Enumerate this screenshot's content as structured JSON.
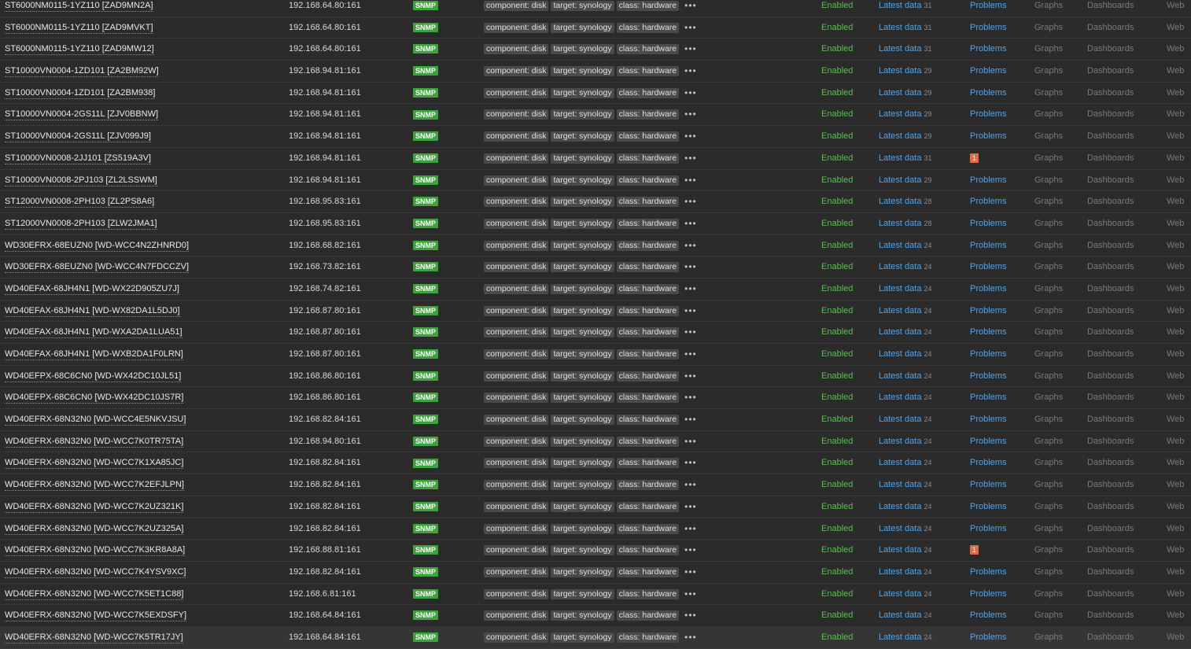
{
  "interface_label": "SNMP",
  "tags": [
    "component: disk",
    "target: synology",
    "class: hardware"
  ],
  "more_label": "•••",
  "status_label": "Enabled",
  "latest_label": "Latest data",
  "problems_label": "Problems",
  "graphs_label": "Graphs",
  "dashboards_label": "Dashboards",
  "web_label": "Web",
  "colors": {
    "background": "#2b2b2b",
    "snmp_badge": "#3ca43b",
    "enabled": "#58c04f",
    "link": "#4ea4f0",
    "problem_badge": "#e56a43"
  },
  "hosts": [
    {
      "name": "ST6000NM0115-1YZ110 [ZAD9MN2A]",
      "ip": "192.168.64.80:161",
      "latest_count": "31",
      "problems": null
    },
    {
      "name": "ST6000NM0115-1YZ110 [ZAD9MVKT]",
      "ip": "192.168.64.80:161",
      "latest_count": "31",
      "problems": null
    },
    {
      "name": "ST6000NM0115-1YZ110 [ZAD9MW12]",
      "ip": "192.168.64.80:161",
      "latest_count": "31",
      "problems": null
    },
    {
      "name": "ST10000VN0004-1ZD101 [ZA2BM92W]",
      "ip": "192.168.94.81:161",
      "latest_count": "29",
      "problems": null
    },
    {
      "name": "ST10000VN0004-1ZD101 [ZA2BM938]",
      "ip": "192.168.94.81:161",
      "latest_count": "29",
      "problems": null
    },
    {
      "name": "ST10000VN0004-2GS11L [ZJV0BBNW]",
      "ip": "192.168.94.81:161",
      "latest_count": "29",
      "problems": null
    },
    {
      "name": "ST10000VN0004-2GS11L [ZJV099J9]",
      "ip": "192.168.94.81:161",
      "latest_count": "29",
      "problems": null
    },
    {
      "name": "ST10000VN0008-2JJ101 [ZS519A3V]",
      "ip": "192.168.94.81:161",
      "latest_count": "31",
      "problems": "1"
    },
    {
      "name": "ST10000VN0008-2PJ103 [ZL2LSSWM]",
      "ip": "192.168.94.81:161",
      "latest_count": "29",
      "problems": null
    },
    {
      "name": "ST12000VN0008-2PH103 [ZL2PS8A6]",
      "ip": "192.168.95.83:161",
      "latest_count": "28",
      "problems": null
    },
    {
      "name": "ST12000VN0008-2PH103 [ZLW2JMA1]",
      "ip": "192.168.95.83:161",
      "latest_count": "28",
      "problems": null
    },
    {
      "name": "WD30EFRX-68EUZN0 [WD-WCC4N2ZHNRD0]",
      "ip": "192.168.68.82:161",
      "latest_count": "24",
      "problems": null
    },
    {
      "name": "WD30EFRX-68EUZN0 [WD-WCC4N7FDCCZV]",
      "ip": "192.168.73.82:161",
      "latest_count": "24",
      "problems": null
    },
    {
      "name": "WD40EFAX-68JH4N1 [WD-WX22D905ZU7J]",
      "ip": "192.168.74.82:161",
      "latest_count": "24",
      "problems": null
    },
    {
      "name": "WD40EFAX-68JH4N1 [WD-WX82DA1L5DJ0]",
      "ip": "192.168.87.80:161",
      "latest_count": "24",
      "problems": null
    },
    {
      "name": "WD40EFAX-68JH4N1 [WD-WXA2DA1LUA51]",
      "ip": "192.168.87.80:161",
      "latest_count": "24",
      "problems": null
    },
    {
      "name": "WD40EFAX-68JH4N1 [WD-WXB2DA1F0LRN]",
      "ip": "192.168.87.80:161",
      "latest_count": "24",
      "problems": null
    },
    {
      "name": "WD40EFPX-68C6CN0 [WD-WX42DC10JL51]",
      "ip": "192.168.86.80:161",
      "latest_count": "24",
      "problems": null
    },
    {
      "name": "WD40EFPX-68C6CN0 [WD-WX42DC10JS7R]",
      "ip": "192.168.86.80:161",
      "latest_count": "24",
      "problems": null
    },
    {
      "name": "WD40EFRX-68N32N0 [WD-WCC4E5NKVJSU]",
      "ip": "192.168.82.84:161",
      "latest_count": "24",
      "problems": null
    },
    {
      "name": "WD40EFRX-68N32N0 [WD-WCC7K0TR75TA]",
      "ip": "192.168.94.80:161",
      "latest_count": "24",
      "problems": null
    },
    {
      "name": "WD40EFRX-68N32N0 [WD-WCC7K1XA85JC]",
      "ip": "192.168.82.84:161",
      "latest_count": "24",
      "problems": null
    },
    {
      "name": "WD40EFRX-68N32N0 [WD-WCC7K2EFJLPN]",
      "ip": "192.168.82.84:161",
      "latest_count": "24",
      "problems": null
    },
    {
      "name": "WD40EFRX-68N32N0 [WD-WCC7K2UZ321K]",
      "ip": "192.168.82.84:161",
      "latest_count": "24",
      "problems": null
    },
    {
      "name": "WD40EFRX-68N32N0 [WD-WCC7K2UZ325A]",
      "ip": "192.168.82.84:161",
      "latest_count": "24",
      "problems": null
    },
    {
      "name": "WD40EFRX-68N32N0 [WD-WCC7K3KR8A8A]",
      "ip": "192.168.88.81:161",
      "latest_count": "24",
      "problems": "1"
    },
    {
      "name": "WD40EFRX-68N32N0 [WD-WCC7K4YSV9XC]",
      "ip": "192.168.82.84:161",
      "latest_count": "24",
      "problems": null
    },
    {
      "name": "WD40EFRX-68N32N0 [WD-WCC7K5ET1C88]",
      "ip": "192.168.6.81:161",
      "latest_count": "24",
      "problems": null
    },
    {
      "name": "WD40EFRX-68N32N0 [WD-WCC7K5EXDSFY]",
      "ip": "192.168.64.84:161",
      "latest_count": "24",
      "problems": null
    },
    {
      "name": "WD40EFRX-68N32N0 [WD-WCC7K5TR17JY]",
      "ip": "192.168.64.84:161",
      "latest_count": "24",
      "problems": null
    }
  ]
}
